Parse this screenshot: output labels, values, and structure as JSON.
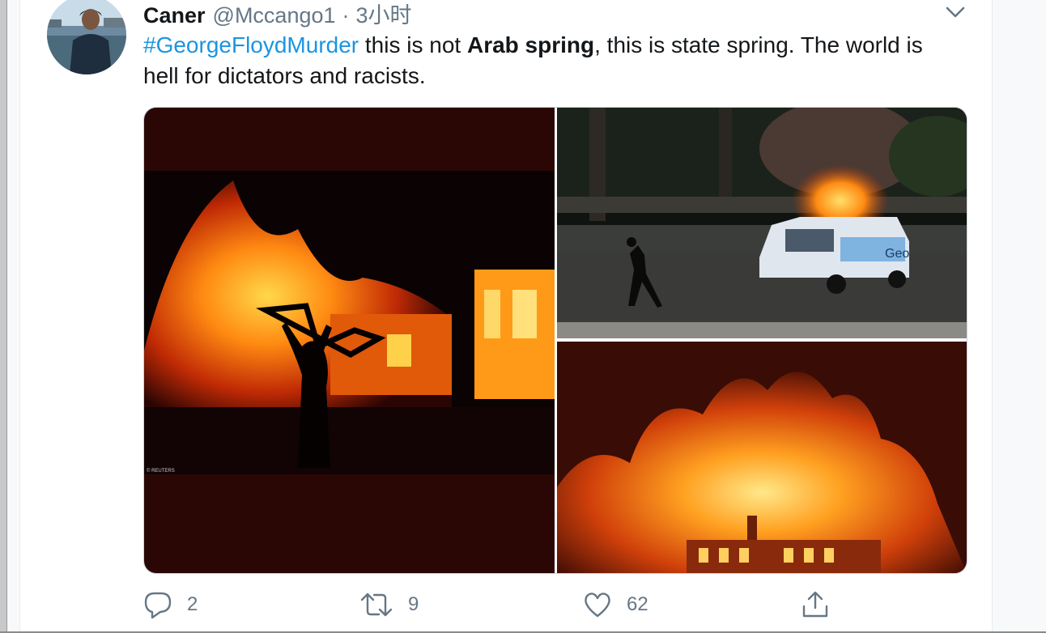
{
  "tweet": {
    "display_name": "Caner",
    "handle": "@Mccango1",
    "separator": "·",
    "time": "3小时",
    "text_parts": [
      "#GeorgeFloydMurder",
      " this is not ",
      "Arab spring",
      ", this is state spring.  The world is hell for dictators and racists."
    ],
    "media": {
      "photo1_credit": "© REUTERS",
      "photo2_van_text": "Geo"
    }
  },
  "actions": {
    "reply_count": "2",
    "retweet_count": "9",
    "like_count": "62"
  },
  "icons": {
    "menu": "chevron-down-icon",
    "reply": "reply-icon",
    "retweet": "retweet-icon",
    "like": "heart-icon",
    "share": "share-icon"
  },
  "colors": {
    "link": "#1b95e0",
    "secondary_text": "#657786",
    "primary_text": "#14171a"
  }
}
